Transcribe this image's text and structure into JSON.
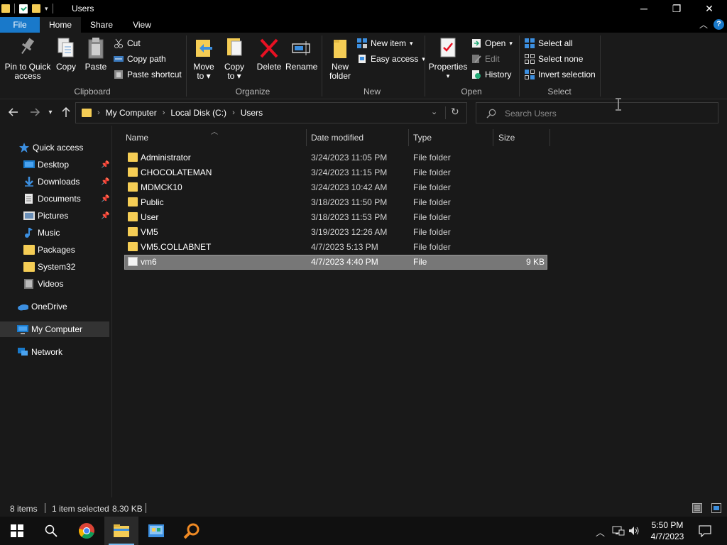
{
  "window": {
    "title": "Users",
    "minimize_glyph": "─",
    "maximize_glyph": "❐",
    "close_glyph": "✕"
  },
  "ribbon_tabs": [
    "File",
    "Home",
    "Share",
    "View"
  ],
  "ribbon": {
    "clipboard": {
      "label": "Clipboard",
      "pin": "Pin to Quick access",
      "pin_line1": "Pin to Quick",
      "pin_line2": "access",
      "copy": "Copy",
      "paste": "Paste",
      "cut": "Cut",
      "copy_path": "Copy path",
      "paste_shortcut": "Paste shortcut"
    },
    "organize": {
      "label": "Organize",
      "move_to_1": "Move",
      "move_to_2": "to",
      "copy_to_1": "Copy",
      "copy_to_2": "to",
      "delete": "Delete",
      "rename": "Rename"
    },
    "new": {
      "label": "New",
      "new_folder_1": "New",
      "new_folder_2": "folder",
      "new_item": "New item",
      "easy_access": "Easy access"
    },
    "open": {
      "label": "Open",
      "properties": "Properties",
      "open": "Open",
      "edit": "Edit",
      "history": "History"
    },
    "select": {
      "label": "Select",
      "select_all": "Select all",
      "select_none": "Select none",
      "invert": "Invert selection"
    }
  },
  "address": {
    "crumbs": [
      "My Computer",
      "Local Disk (C:)",
      "Users"
    ],
    "search_placeholder": "Search Users"
  },
  "sidebar": {
    "items": [
      {
        "label": "Quick access"
      },
      {
        "label": "Desktop"
      },
      {
        "label": "Downloads"
      },
      {
        "label": "Documents"
      },
      {
        "label": "Pictures"
      },
      {
        "label": "Music"
      },
      {
        "label": "Packages"
      },
      {
        "label": "System32"
      },
      {
        "label": "Videos"
      },
      {
        "label": "OneDrive"
      },
      {
        "label": "My Computer"
      },
      {
        "label": "Network"
      }
    ]
  },
  "columns": {
    "name": "Name",
    "date": "Date modified",
    "type": "Type",
    "size": "Size"
  },
  "files": [
    {
      "name": "Administrator",
      "date": "3/24/2023 11:05 PM",
      "type": "File folder",
      "size": ""
    },
    {
      "name": "CHOCOLATEMAN",
      "date": "3/24/2023 11:15 PM",
      "type": "File folder",
      "size": ""
    },
    {
      "name": "MDMCK10",
      "date": "3/24/2023 10:42 AM",
      "type": "File folder",
      "size": ""
    },
    {
      "name": "Public",
      "date": "3/18/2023 11:50 PM",
      "type": "File folder",
      "size": ""
    },
    {
      "name": "User",
      "date": "3/18/2023 11:53 PM",
      "type": "File folder",
      "size": ""
    },
    {
      "name": "VM5",
      "date": "3/19/2023 12:26 AM",
      "type": "File folder",
      "size": ""
    },
    {
      "name": "VM5.COLLABNET",
      "date": "4/7/2023 5:13 PM",
      "type": "File folder",
      "size": ""
    },
    {
      "name": "vm6",
      "date": "4/7/2023 4:40 PM",
      "type": "File",
      "size": "9 KB"
    }
  ],
  "status": {
    "count": "8 items",
    "selection": "1 item selected",
    "size": "8.30 KB"
  },
  "taskbar": {
    "time": "5:50 PM",
    "date": "4/7/2023"
  },
  "colors": {
    "accent": "#1979ca",
    "folder": "#f5cd55",
    "background": "#191919"
  }
}
